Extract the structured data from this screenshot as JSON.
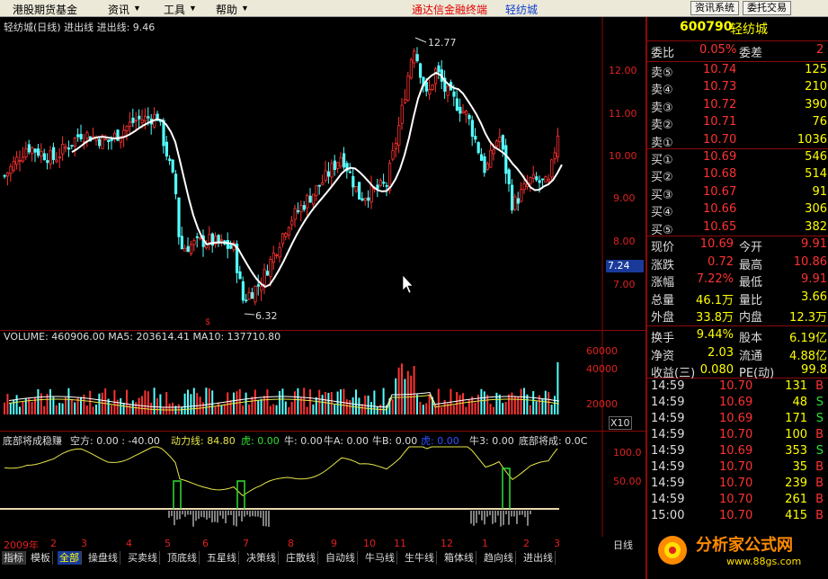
{
  "menu": {
    "items": [
      "港股期货基金",
      "资讯",
      "工具",
      "帮助"
    ],
    "arrows": [
      "▼",
      "▼",
      "▼"
    ],
    "center_title": "通达信金融终端",
    "center_stock": "轻纺城",
    "btn_news": "资讯系统",
    "btn_trade": "委托交易"
  },
  "chart": {
    "header_left": "轻纺城(日线) 进出线 进出线: 9.46",
    "high_label": "12.77",
    "low_label": "6.32",
    "price_axis": [
      "12.00",
      "11.00",
      "10.00",
      "9.00",
      "8.00",
      "7.00"
    ],
    "cur_price_tag": "7.24",
    "volume_header": "VOLUME: 460906.00  MA5: 203614.41  MA10: 137710.80",
    "volume_axis": [
      "60000",
      "40000",
      "20000"
    ],
    "volume_unit": "X10",
    "indicator_header": [
      "底部将成稳赚",
      "空方: 0.00 : -40.00",
      "动力线: 84.80",
      "虎: 0.00",
      "牛: 0.00",
      "牛A: 0.00",
      "牛B: 0.00",
      "虎: 0.00",
      "牛3: 0.00",
      "底部将成: 0.0C"
    ],
    "indicator_axis": [
      "100.0",
      "50.00"
    ],
    "x_labels": [
      "2009年",
      "2",
      "3",
      "4",
      "5",
      "6",
      "7",
      "8",
      "9",
      "10",
      "11",
      "12",
      "1",
      "2",
      "3"
    ],
    "period": "日线",
    "marker": "$"
  },
  "tabs": [
    "指标",
    "模板",
    "全部",
    "操盘线",
    "买卖线",
    "顶底线",
    "五星线",
    "决策线",
    "庄散线",
    "自动线",
    "牛马线",
    "生牛线",
    "箱体线",
    "趋向线",
    "进出线"
  ],
  "active_tab": "全部",
  "quote": {
    "code": "600790",
    "name": "轻纺城",
    "weibi_label": "委比",
    "weibi": "0.05%",
    "weicha_label": "委差",
    "weicha": "2",
    "asks": [
      {
        "label": "卖⑤",
        "price": "10.74",
        "vol": "125"
      },
      {
        "label": "卖④",
        "price": "10.73",
        "vol": "210"
      },
      {
        "label": "卖③",
        "price": "10.72",
        "vol": "390"
      },
      {
        "label": "卖②",
        "price": "10.71",
        "vol": "76"
      },
      {
        "label": "卖①",
        "price": "10.70",
        "vol": "1036"
      }
    ],
    "bids": [
      {
        "label": "买①",
        "price": "10.69",
        "vol": "546"
      },
      {
        "label": "买②",
        "price": "10.68",
        "vol": "514"
      },
      {
        "label": "买③",
        "price": "10.67",
        "vol": "91"
      },
      {
        "label": "买④",
        "price": "10.66",
        "vol": "306"
      },
      {
        "label": "买⑤",
        "price": "10.65",
        "vol": "382"
      }
    ],
    "stats": [
      {
        "l1": "现价",
        "v1": "10.69",
        "l2": "今开",
        "v2": "9.91"
      },
      {
        "l1": "涨跌",
        "v1": "0.72",
        "l2": "最高",
        "v2": "10.86"
      },
      {
        "l1": "涨幅",
        "v1": "7.22%",
        "l2": "最低",
        "v2": "9.91"
      },
      {
        "l1": "总量",
        "v1": "46.1万",
        "l2": "量比",
        "v2": "3.66"
      },
      {
        "l1": "外盘",
        "v1": "33.8万",
        "l2": "内盘",
        "v2": "12.3万"
      }
    ],
    "stats2": [
      {
        "l1": "换手",
        "v1": "9.44%",
        "l2": "股本",
        "v2": "6.19亿"
      },
      {
        "l1": "净资",
        "v1": "2.03",
        "l2": "流通",
        "v2": "4.88亿"
      },
      {
        "l1": "收益(三)",
        "v1": "0.080",
        "l2": "PE(动)",
        "v2": "99.8"
      }
    ],
    "ticks": [
      {
        "t": "14:59",
        "p": "10.70",
        "v": "131",
        "d": "B"
      },
      {
        "t": "14:59",
        "p": "10.69",
        "v": "48",
        "d": "S"
      },
      {
        "t": "14:59",
        "p": "10.69",
        "v": "171",
        "d": "S"
      },
      {
        "t": "14:59",
        "p": "10.70",
        "v": "100",
        "d": "B"
      },
      {
        "t": "14:59",
        "p": "10.69",
        "v": "353",
        "d": "S"
      },
      {
        "t": "14:59",
        "p": "10.70",
        "v": "35",
        "d": "B"
      },
      {
        "t": "14:59",
        "p": "10.70",
        "v": "239",
        "d": "B"
      },
      {
        "t": "14:59",
        "p": "10.70",
        "v": "261",
        "d": "B"
      },
      {
        "t": "15:00",
        "p": "10.70",
        "v": "415",
        "d": "B"
      }
    ]
  },
  "watermark": {
    "title": "分析家公式网",
    "url": "www.88gs.com"
  },
  "colors": {
    "up": "#ff3232",
    "down": "#54ffff",
    "ma": "#ffffff",
    "indicator": "#e6e64a",
    "accent": "#ffff00"
  }
}
